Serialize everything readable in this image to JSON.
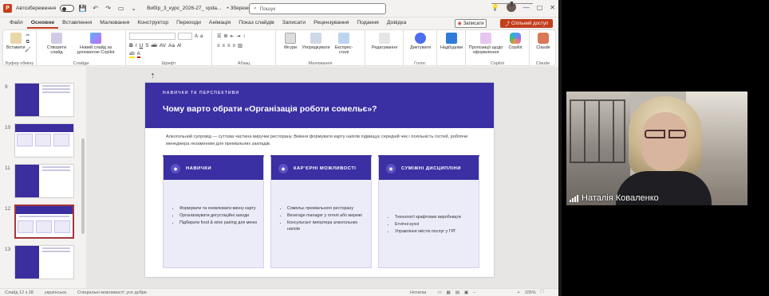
{
  "titlebar": {
    "app_icon": "P",
    "autosave_label": "Автозбереження",
    "doc_title": "ВибІр_3_курс_2026-27_ vpda...",
    "save_status": "• Збережено у цій ПК",
    "search_placeholder": "Пошук",
    "icons": [
      "save-icon",
      "undo-icon",
      "redo-icon",
      "present-icon",
      "lightbulb-icon",
      "minimize-icon",
      "maximize-icon",
      "close-icon"
    ]
  },
  "menu": {
    "tabs": [
      "Файл",
      "Основне",
      "Вставлення",
      "Малювання",
      "Конструктор",
      "Переходи",
      "Анімація",
      "Показ слайдів",
      "Записати",
      "Рецензування",
      "Подання",
      "Довідка"
    ],
    "active_index": 1,
    "record_label": "Записати",
    "share_label": "Спільний доступ"
  },
  "ribbon": {
    "groups": [
      {
        "label": "Буфер обміну",
        "buttons": [
          "Вставити"
        ]
      },
      {
        "label": "Слайди",
        "buttons": [
          "Створити слайд",
          "Новий слайд за допомогою Copilot"
        ]
      },
      {
        "label": "Шрифт",
        "buttons": []
      },
      {
        "label": "Абзац",
        "buttons": []
      },
      {
        "label": "Малювання",
        "buttons": [
          "Фігури",
          "Упорядкувати",
          "Експрес-стилі"
        ]
      },
      {
        "label": "",
        "buttons": [
          "Редагування"
        ]
      },
      {
        "label": "Голос",
        "buttons": [
          "Диктувати"
        ]
      },
      {
        "label": "",
        "buttons": [
          "Надбудови"
        ]
      },
      {
        "label": "Copilot",
        "buttons": [
          "Пропозиції щодо оформлення",
          "Copilot"
        ]
      },
      {
        "label": "Claude",
        "buttons": [
          "Claude"
        ]
      }
    ]
  },
  "thumbnails": [
    {
      "num": "9",
      "selected": false
    },
    {
      "num": "10",
      "selected": false
    },
    {
      "num": "11",
      "selected": false
    },
    {
      "num": "12",
      "selected": true
    },
    {
      "num": "13",
      "selected": false
    }
  ],
  "slide": {
    "kicker": "НАВИЧКИ ТА ПЕРСПЕКТИВИ",
    "title": "Чому варто обрати «Організація роботи сомельє»?",
    "intro": "Алкогольний супровід — суттєва частина виручки ресторану. Вміння формувати карту напоїв підвищує середній чек і лояльність гостей, роблячи менеджера незамінним для преміальних закладів.",
    "cards": [
      {
        "title": "НАВИЧКИ",
        "icon": "◆",
        "items": [
          "Формувати та оновлювати винну карту",
          "Організовувати дегустаційні заходи",
          "Підбирати food & wine pairing для меню"
        ]
      },
      {
        "title": "КАР'ЄРНІ МОЖЛИВОСТІ",
        "icon": "◆",
        "items": [
          "Сомельє преміального ресторану",
          "Beverage manager у готелі або мережі",
          "Консультант імпортера алкогольних напоїв"
        ]
      },
      {
        "title": "СУМІЖНІ ДИСЦИПЛІНИ",
        "icon": "◉",
        "items": [
          "Технології крафтових виробництв",
          "Етнічні кухні",
          "Управління якістю послуг у ГРГ"
        ]
      }
    ]
  },
  "statusbar": {
    "slide_counter": "Слайд 12 з 28",
    "language": "українська",
    "accessibility": "Спеціальні можливості: усе добре",
    "notes_label": "Нотатки",
    "zoom": "105%"
  },
  "video": {
    "participant_name": "Наталія Коваленко"
  }
}
